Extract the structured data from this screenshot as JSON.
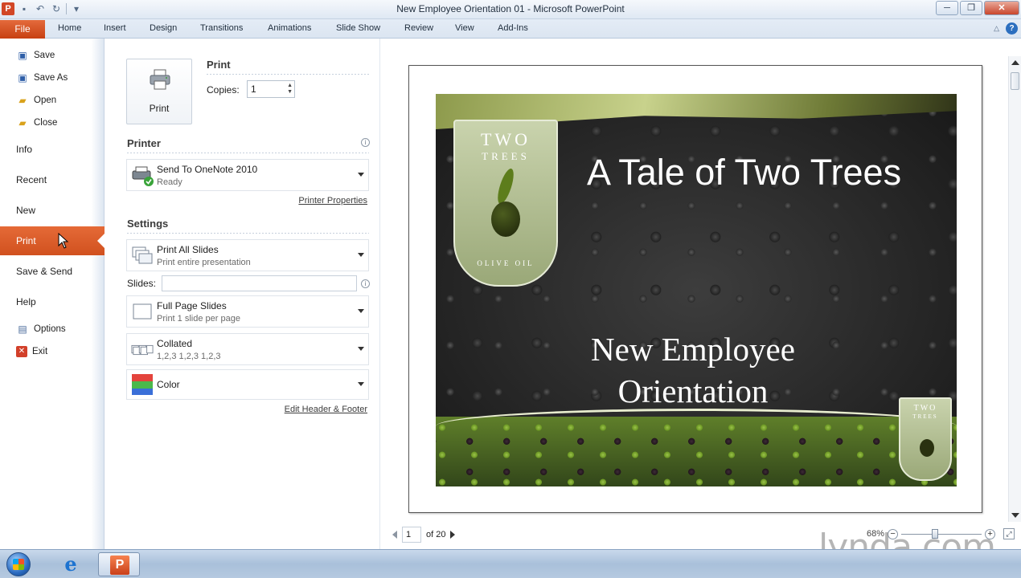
{
  "window": {
    "title": "New Employee Orientation 01  -  Microsoft PowerPoint"
  },
  "ribbon": {
    "file_tab": "File",
    "tabs": [
      "Home",
      "Insert",
      "Design",
      "Transitions",
      "Animations",
      "Slide Show",
      "Review",
      "View",
      "Add-Ins"
    ]
  },
  "nav": {
    "save": "Save",
    "save_as": "Save As",
    "open": "Open",
    "close": "Close",
    "info": "Info",
    "recent": "Recent",
    "new": "New",
    "print": "Print",
    "save_send": "Save & Send",
    "help": "Help",
    "options": "Options",
    "exit": "Exit"
  },
  "print_panel": {
    "print_button_label": "Print",
    "print_title": "Print",
    "copies_label": "Copies:",
    "copies_value": "1",
    "printer_title": "Printer",
    "printer_name": "Send To OneNote 2010",
    "printer_status": "Ready",
    "printer_properties_link": "Printer Properties",
    "settings_title": "Settings",
    "slides_range_main": "Print All Slides",
    "slides_range_sub": "Print entire presentation",
    "slides_label": "Slides:",
    "slides_value": "",
    "layout_main": "Full Page Slides",
    "layout_sub": "Print 1 slide per page",
    "collate_main": "Collated",
    "collate_sub": "1,2,3    1,2,3    1,2,3",
    "color_main": "Color",
    "header_footer_link": "Edit Header & Footer"
  },
  "slide": {
    "logo_line1": "TWO",
    "logo_line2": "TREES",
    "logo_line3": "OLIVE OIL",
    "title": "A Tale of Two Trees",
    "subtitle_line1": "New Employee",
    "subtitle_line2": "Orientation"
  },
  "preview_nav": {
    "current_page": "1",
    "total_pages": "of 20",
    "zoom": "68%"
  },
  "watermark": "lynda.com",
  "colors": {
    "accent_orange": "#d1511f",
    "ribbon_blue": "#dbe5f1"
  }
}
